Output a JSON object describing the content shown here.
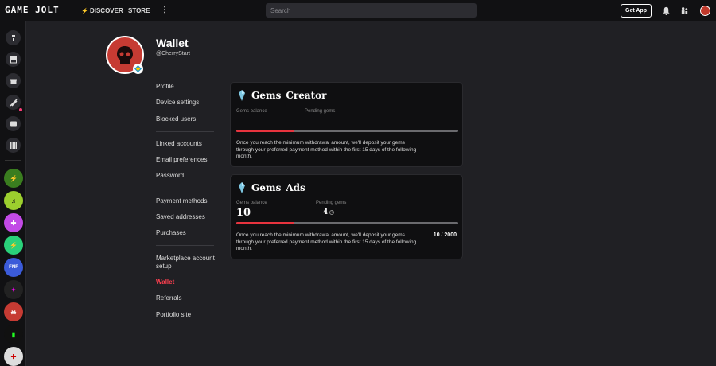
{
  "topbar": {
    "logo": "GAME JOLT",
    "discover": "DISCOVER",
    "store": "STORE",
    "more": "⋮",
    "search_placeholder": "Search",
    "get_app": "Get App"
  },
  "profile": {
    "title": "Wallet",
    "username": "@CherryStart"
  },
  "menu": {
    "group1": [
      "Profile",
      "Device settings",
      "Blocked users"
    ],
    "group2": [
      "Linked accounts",
      "Email preferences",
      "Password"
    ],
    "group3": [
      "Payment methods",
      "Saved addresses",
      "Purchases"
    ],
    "group4": [
      "Marketplace account",
      "setup",
      "Wallet",
      "Referrals",
      "Portfolio site"
    ]
  },
  "cards": {
    "creator": {
      "title": "Gems",
      "subtitle": "Creator",
      "balance_label": "Gems balance",
      "pending_label": "Pending gems",
      "progress": 0.26,
      "description": "Once you reach the minimum withdrawal amount, we'll deposit your gems through your preferred payment method within the first 15 days of the following month."
    },
    "ads": {
      "title": "Gems",
      "subtitle": "Ads",
      "balance_label": "Gems balance",
      "balance_value": "10",
      "pending_label": "Pending gems",
      "pending_value": "4",
      "progress": 0.26,
      "count": "10 / 2000",
      "description": "Once you reach the minimum withdrawal amount, we'll deposit your gems through your preferred payment method within the first 15 days of the following month."
    }
  },
  "colors": {
    "accent": "#e7333e",
    "active_menu": "#ff3f4f",
    "background": "#202024"
  }
}
